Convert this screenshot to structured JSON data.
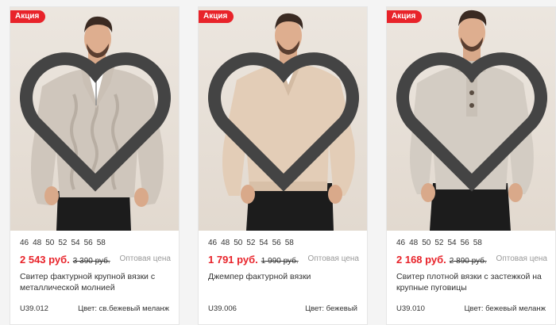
{
  "badge_label": "Акция",
  "price_label": "Оптовая цена",
  "colors": {
    "accent": "#e8232a",
    "muted": "#999999"
  },
  "products": [
    {
      "sizes": [
        "46",
        "48",
        "50",
        "52",
        "54",
        "56",
        "58"
      ],
      "price_new": "2 543 руб.",
      "price_old": "3 390 руб.",
      "title": "Свитер фактурной крупной вязки с металлической молнией",
      "sku": "U39.012",
      "color": "Цвет: св.бежевый меланж"
    },
    {
      "sizes": [
        "46",
        "48",
        "50",
        "52",
        "54",
        "56",
        "58"
      ],
      "price_new": "1 791 руб.",
      "price_old": "1 990 руб.",
      "title": "Джемпер фактурной вязки",
      "sku": "U39.006",
      "color": "Цвет: бежевый"
    },
    {
      "sizes": [
        "46",
        "48",
        "50",
        "52",
        "54",
        "56",
        "58"
      ],
      "price_new": "2 168 руб.",
      "price_old": "2 890 руб.",
      "title": "Свитер плотной вязки с застежкой на крупные пуговицы",
      "sku": "U39.010",
      "color": "Цвет: бежевый меланж"
    }
  ]
}
